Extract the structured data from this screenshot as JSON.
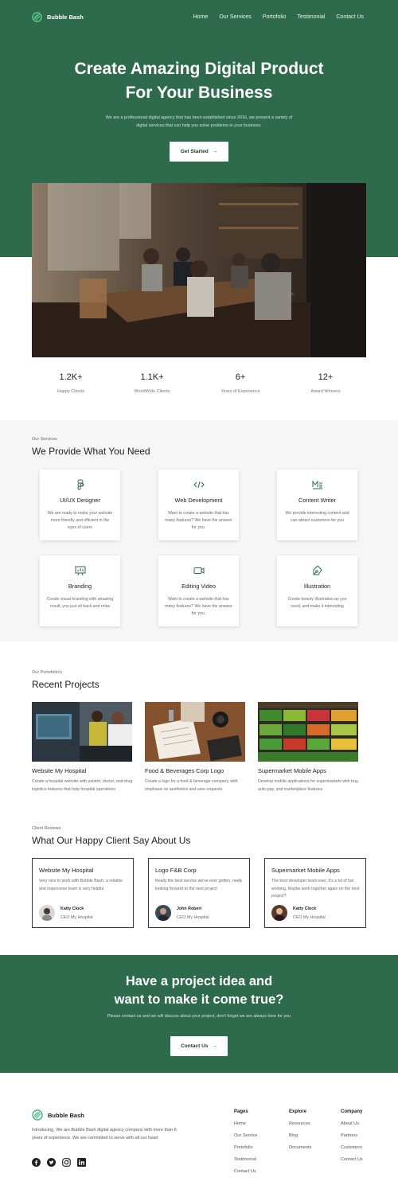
{
  "nav": {
    "brand": "Bubble Bash",
    "links": [
      "Home",
      "Our Services",
      "Portofolio",
      "Testimonial",
      "Contact Us"
    ]
  },
  "hero": {
    "title_line1": "Create Amazing Digital Product",
    "title_line2": "For Your Business",
    "subtitle_line1": "We are a professional digital agency that has been established since 2016, we present a variety of",
    "subtitle_line2": "digital services that can help you solve problems in your business.",
    "cta_label": "Get Started"
  },
  "stats": [
    {
      "value": "1.2K+",
      "label": "Happy Clients"
    },
    {
      "value": "1.1K+",
      "label": "WorldWide Clients"
    },
    {
      "value": "6+",
      "label": "Years of Experience"
    },
    {
      "value": "12+",
      "label": "Award Winners"
    }
  ],
  "services": {
    "eyebrow": "Our Services",
    "title": "We Provide What You Need",
    "items": [
      {
        "icon": "figma-icon",
        "title": "UI/UX Designer",
        "desc": "We are ready to make your website more friendly and efficient in the eyes of users"
      },
      {
        "icon": "code-icon",
        "title": "Web Development",
        "desc": "Want to create a website that has many features? We have the answer for you."
      },
      {
        "icon": "markdown-icon",
        "title": "Content Writer",
        "desc": "We provide interesting content and can attract customers for you"
      },
      {
        "icon": "presentation-icon",
        "title": "Branding",
        "desc": "Create visual branding with amazing result, you just sit back and relax"
      },
      {
        "icon": "video-icon",
        "title": "Editing Video",
        "desc": "Want to create a website that has many features? We have the answer for you."
      },
      {
        "icon": "pen-tool-icon",
        "title": "Illustration",
        "desc": "Create beauty illustration as you need, and make it interesting"
      }
    ]
  },
  "projects": {
    "eyebrow": "Our Portofolio's",
    "title": "Recent Projects",
    "items": [
      {
        "title": "Website My Hospital",
        "desc": "Create a hospital website with patient, doctor, and drug logistics features that help hospital operations"
      },
      {
        "title": "Food & Beverages Corp Logo",
        "desc": "Create a logo for a food & beverage company, with emphasis on aesthetics and user requests"
      },
      {
        "title": "Supermarket Mobile Apps",
        "desc": "Develop mobile applications for supermarkets with buy, auto-pay, and marketplace features"
      }
    ]
  },
  "reviews": {
    "eyebrow": "Client Reviews",
    "title": "What Our Happy Client Say About Us",
    "items": [
      {
        "title": "Website My Hospital",
        "quote": "Very nice to work with Bubble Bash, a reliable and responsive team is very helpful",
        "name": "Katty Clock",
        "role": "CEO My Hospital"
      },
      {
        "title": "Logo F&B Corp",
        "quote": "Really the best service we've ever gotten, really looking forward to the next project",
        "name": "John Robert",
        "role": "CEO My Hospital"
      },
      {
        "title": "Supermarket Mobile Apps",
        "quote": "The best developer team ever, it's a lot of fun working, Maybe work together again on the next project?",
        "name": "Katty Clock",
        "role": "CEO My Hospital"
      }
    ]
  },
  "cta": {
    "title_line1": "Have a project idea and",
    "title_line2": "want to make it come true?",
    "subtitle": "Please contact us and we will discuss about your project, don't forget we are always here for you",
    "button": "Contact Us"
  },
  "footer": {
    "brand": "Bubble Bash",
    "about": "Introducing, We are Bubble Bash digital agency company with more than 6 years of experience. We are committed to serve with all our heart",
    "social": [
      "facebook-icon",
      "twitter-icon",
      "instagram-icon",
      "linkedin-icon"
    ],
    "columns": [
      {
        "heading": "Pages",
        "links": [
          "Home",
          "Our Service",
          "Portofolio",
          "Testimonial",
          "Contact Us"
        ]
      },
      {
        "heading": "Explore",
        "links": [
          "Resources",
          "Blog",
          "Documents"
        ]
      },
      {
        "heading": "Company",
        "links": [
          "About Us",
          "Partners",
          "Customers",
          "Contact Us"
        ]
      }
    ]
  },
  "colors": {
    "brand_green": "#2e6b4d",
    "accent_green": "#3cb878"
  }
}
